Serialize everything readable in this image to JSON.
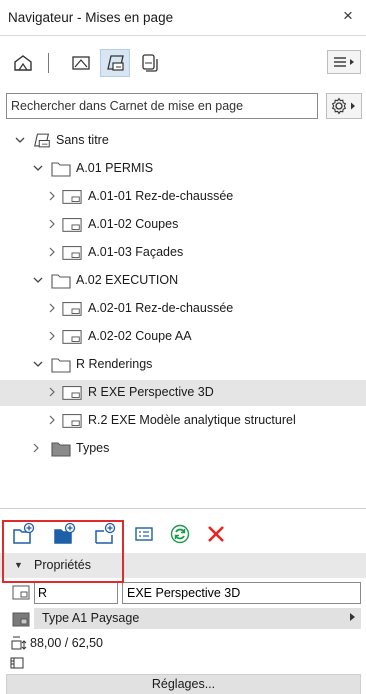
{
  "window": {
    "title": "Navigateur - Mises en page",
    "close_glyph": "×"
  },
  "modes": [
    {
      "icon": "project-map-icon",
      "active": false
    },
    {
      "icon": "view-map-icon",
      "active": false
    },
    {
      "icon": "layout-book-icon",
      "active": true
    },
    {
      "icon": "publisher-sets-icon",
      "active": false
    }
  ],
  "search": {
    "placeholder": "Rechercher dans Carnet de mise en page"
  },
  "tree": {
    "root": "Sans titre",
    "items": [
      {
        "label": "A.01 PERMIS"
      },
      {
        "label": "A.01-01 Rez-de-chaussée"
      },
      {
        "label": "A.01-02 Coupes"
      },
      {
        "label": "A.01-03 Façades"
      },
      {
        "label": "A.02 EXECUTION"
      },
      {
        "label": "A.02-01 Rez-de-chaussée"
      },
      {
        "label": "A.02-02 Coupe AA"
      },
      {
        "label": "R Renderings"
      },
      {
        "label": "R EXE Perspective 3D",
        "selected": true
      },
      {
        "label": "R.2 EXE Modèle analytique structurel"
      },
      {
        "label": "Types"
      }
    ]
  },
  "toolbar": {
    "buttons": [
      "new-subset-icon",
      "new-master-icon",
      "new-layout-icon",
      "properties-icon",
      "update-icon",
      "delete-icon"
    ]
  },
  "properties": {
    "header": "Propriétés",
    "id_value": "R",
    "name_value": "EXE Perspective 3D",
    "master_type": "Type A1 Paysage",
    "size": "88,00 / 62,50",
    "settings_label": "Réglages..."
  },
  "colors": {
    "accent_green": "#1a9b4a",
    "delete_red": "#e8231e",
    "highlight_red": "#e02b2b",
    "active_mode_bg": "#d8e6f3"
  }
}
